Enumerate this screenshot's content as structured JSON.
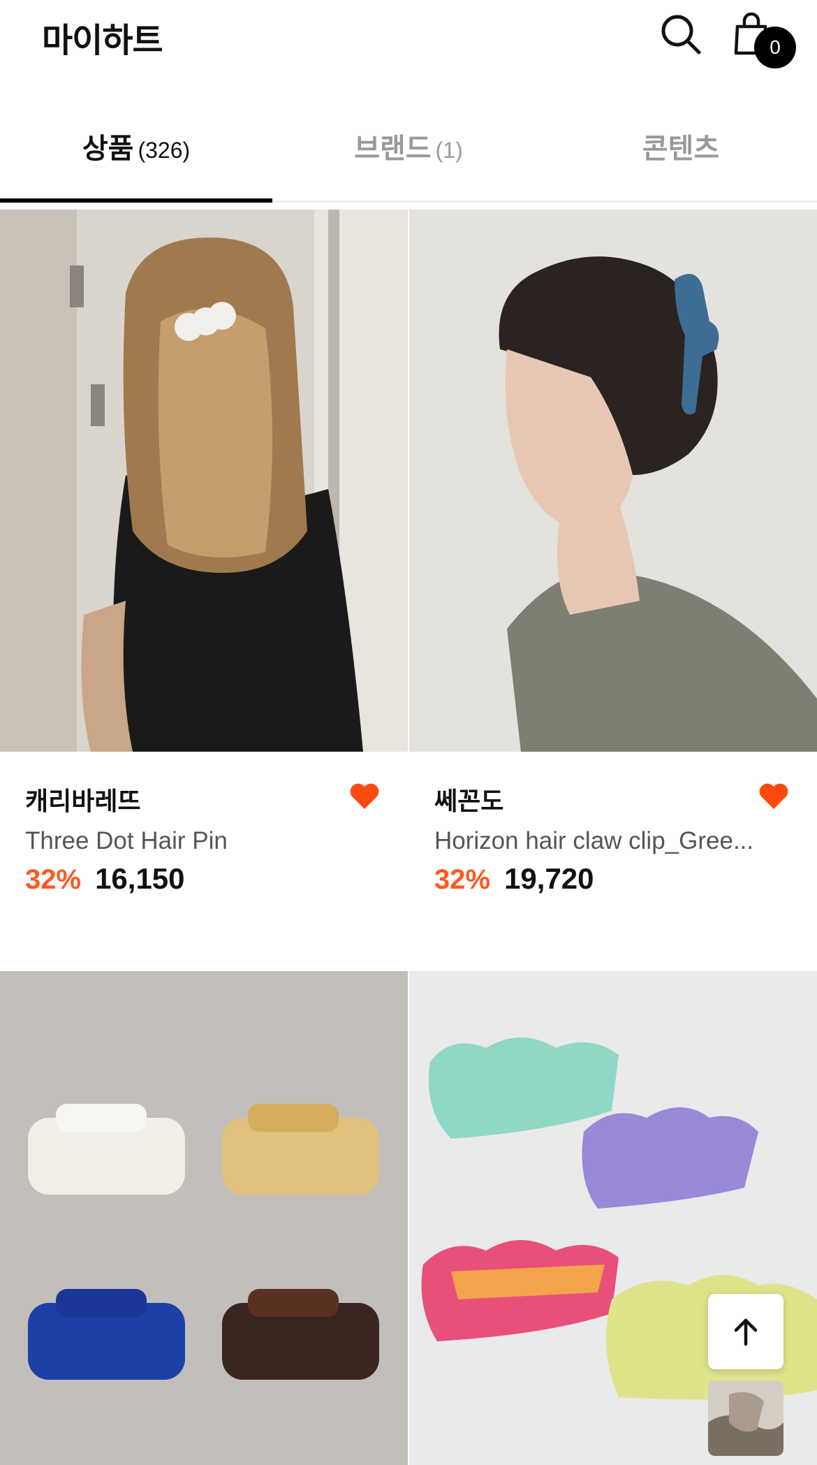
{
  "header": {
    "title": "마이하트",
    "search_icon": "search-icon",
    "cart_icon": "shopping-bag-icon",
    "cart_count": "0"
  },
  "tabs": [
    {
      "label": "상품",
      "count": "(326)",
      "active": true
    },
    {
      "label": "브랜드",
      "count": "(1)",
      "active": false
    },
    {
      "label": "콘텐츠",
      "count": "",
      "active": false
    }
  ],
  "products": [
    {
      "brand": "캐리바레뜨",
      "name": "Three Dot Hair Pin",
      "discount": "32%",
      "price": "16,150",
      "liked": true
    },
    {
      "brand": "쎄꼰도",
      "name": "Horizon hair claw clip_Gree...",
      "discount": "32%",
      "price": "19,720",
      "liked": true
    }
  ],
  "colors": {
    "accent": "#ff5a1f",
    "heart": "#ff4a0f",
    "text": "#111111",
    "muted": "#999999"
  },
  "floating": {
    "top_icon": "arrow-up-icon"
  }
}
